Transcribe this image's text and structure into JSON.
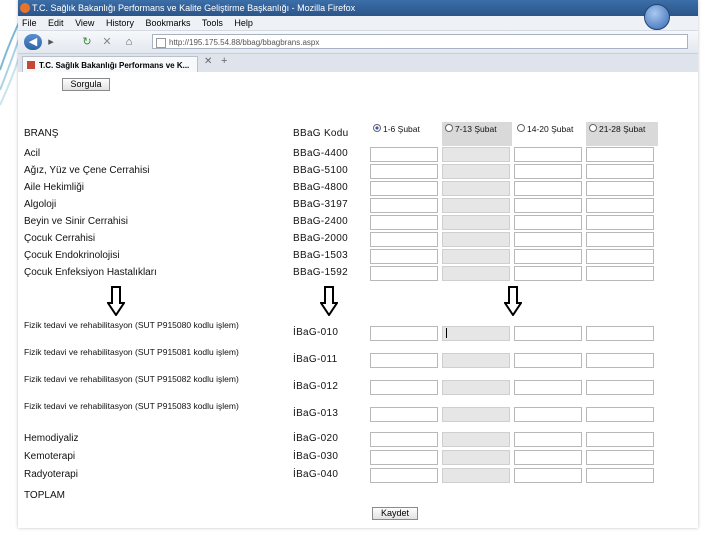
{
  "window": {
    "title": "T.C. Sağlık Bakanlığı Performans ve Kalite Geliştirme Başkanlığı - Mozilla Firefox"
  },
  "menu": [
    "File",
    "Edit",
    "View",
    "History",
    "Bookmarks",
    "Tools",
    "Help"
  ],
  "nav": {
    "back": "◀",
    "forward": "▸",
    "reload": "↻",
    "stop": "✕",
    "home": "⌂",
    "url": "http://195.175.54.88/bbag/bbagbrans.aspx"
  },
  "tab": {
    "label": "T.C. Sağlık Bakanlığı Performans ve K...",
    "close": "✕",
    "new": "+"
  },
  "form": {
    "sorgula_label": "Sorgula",
    "kaydet_label": "Kaydet",
    "header_brans": "BRANŞ",
    "header_code": "BBaG Kodu",
    "periods": [
      {
        "label": "1-6 Şubat",
        "checked": true
      },
      {
        "label": "7-13 Şubat",
        "checked": false
      },
      {
        "label": "14-20 Şubat",
        "checked": false
      },
      {
        "label": "21-28 Şubat",
        "checked": false
      }
    ],
    "rows_top": [
      {
        "name": "Acil",
        "code": "BBaG-4400"
      },
      {
        "name": "Ağız, Yüz ve Çene Cerrahisi",
        "code": "BBaG-5100"
      },
      {
        "name": "Aile Hekimliği",
        "code": "BBaG-4800"
      },
      {
        "name": "Algoloji",
        "code": "BBaG-3197"
      },
      {
        "name": "Beyin ve Sinir Cerrahisi",
        "code": "BBaG-2400"
      },
      {
        "name": "Çocuk Cerrahisi",
        "code": "BBaG-2000"
      },
      {
        "name": "Çocuk Endokrinolojisi",
        "code": "BBaG-1503"
      },
      {
        "name": "Çocuk Enfeksiyon Hastalıkları",
        "code": "BBaG-1592"
      }
    ],
    "rows_bottom": [
      {
        "name": "Fizik tedavi ve rehabilitasyon (SUT P915080 kodlu işlem)",
        "code": "İBaG-010"
      },
      {
        "name": "Fizik tedavi ve rehabilitasyon (SUT P915081 kodlu işlem)",
        "code": "İBaG-011"
      },
      {
        "name": "Fizik tedavi ve rehabilitasyon (SUT P915082 kodlu işlem)",
        "code": "İBaG-012"
      },
      {
        "name": "Fizik tedavi ve rehabilitasyon (SUT P915083 kodlu işlem)",
        "code": "İBaG-013"
      },
      {
        "name": "Hemodiyaliz",
        "code": "İBaG-020"
      },
      {
        "name": "Kemoterapi",
        "code": "İBaG-030"
      },
      {
        "name": "Radyoterapi",
        "code": "İBaG-040"
      }
    ],
    "total_label": "TOPLAM"
  }
}
